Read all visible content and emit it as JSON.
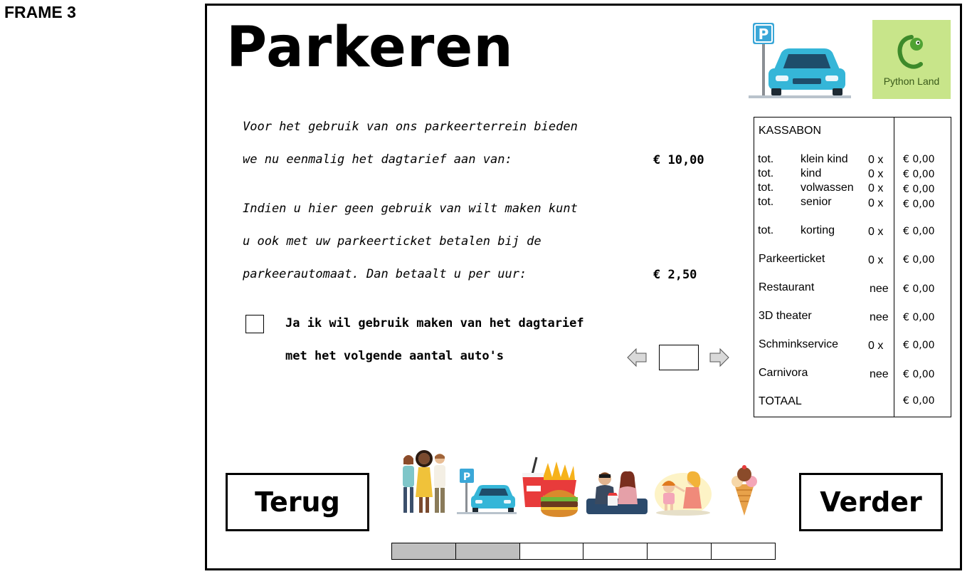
{
  "frame_label": "FRAME 3",
  "title": "Parkeren",
  "intro": {
    "line1": "Voor het gebruik van ons parkeerterrein bieden",
    "line2": "we nu eenmalig het dagtarief aan van:",
    "day_price": "€ 10,00",
    "line3": "Indien u hier geen gebruik van wilt maken kunt",
    "line4": "u ook met uw parkeerticket betalen bij de",
    "line5": "parkeerautomaat. Dan betaalt u per uur:",
    "hour_price": "€ 2,50"
  },
  "checkbox": {
    "checked": false,
    "line1": "Ja ik wil gebruik maken van het dagtarief",
    "line2": "met het volgende aantal auto's"
  },
  "counter": {
    "value": ""
  },
  "logo": {
    "text": "Python Land",
    "color": "#c8e58a"
  },
  "receipt": {
    "title": "KASSABON",
    "rows": [
      {
        "prefix": "tot.",
        "label": "klein kind",
        "qty": "0 x",
        "amount": "€ 0,00"
      },
      {
        "prefix": "tot.",
        "label": "kind",
        "qty": "0 x",
        "amount": "€ 0,00"
      },
      {
        "prefix": "tot.",
        "label": "volwassen",
        "qty": "0 x",
        "amount": "€ 0,00"
      },
      {
        "prefix": "tot.",
        "label": "senior",
        "qty": "0 x",
        "amount": "€ 0,00"
      },
      {
        "prefix": "tot.",
        "label": "korting",
        "qty": "0 x",
        "amount": "€ 0,00"
      },
      {
        "prefix": "",
        "label": "Parkeerticket",
        "qty": "0 x",
        "amount": "€ 0,00"
      },
      {
        "prefix": "",
        "label": "Restaurant",
        "qty": "nee",
        "amount": "€ 0,00"
      },
      {
        "prefix": "",
        "label": "3D theater",
        "qty": "nee",
        "amount": "€ 0,00"
      },
      {
        "prefix": "",
        "label": "Schminkservice",
        "qty": "0 x",
        "amount": "€ 0,00"
      },
      {
        "prefix": "",
        "label": "Carnivora",
        "qty": "nee",
        "amount": "€ 0,00"
      }
    ],
    "total_label": "TOTAAL",
    "total_amount": "€ 0,00"
  },
  "buttons": {
    "back": "Terug",
    "next": "Verder"
  },
  "progress": {
    "total_steps": 6,
    "completed_steps": 2,
    "done_color": "#bfbfbf"
  },
  "icons": [
    "parking-car-icon",
    "python-land-logo",
    "family-icon",
    "parking-icon",
    "fast-food-icon",
    "theater-icon",
    "face-paint-icon",
    "ice-cream-icon",
    "arrow-left-icon",
    "arrow-right-icon"
  ]
}
